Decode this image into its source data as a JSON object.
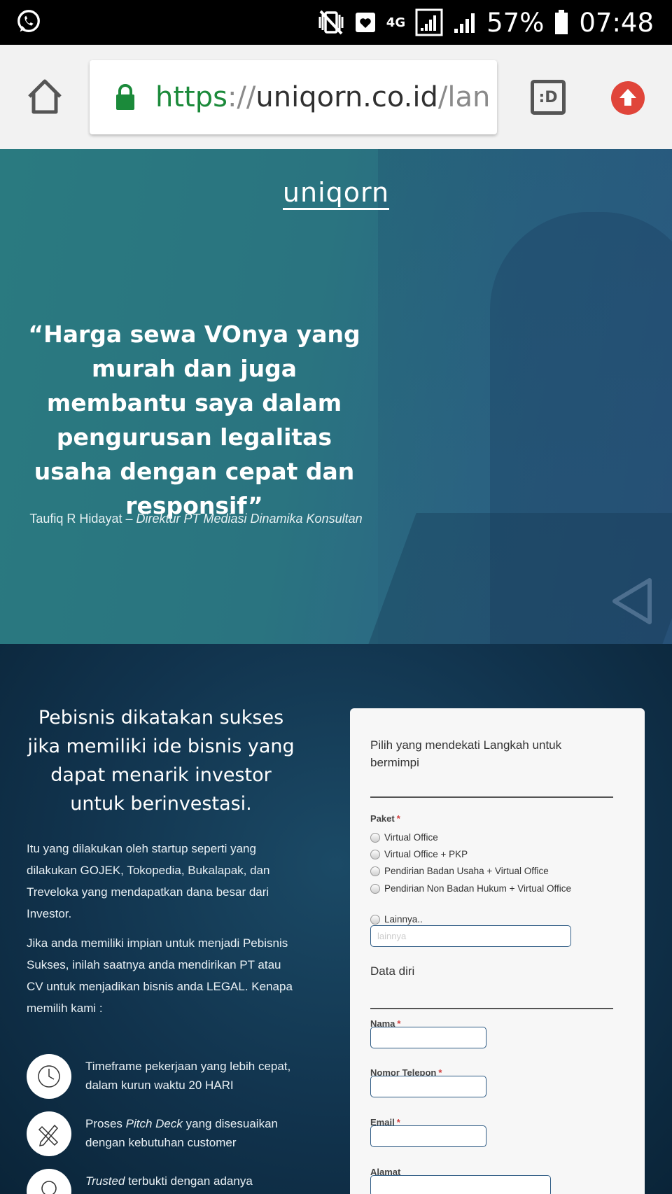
{
  "status_bar": {
    "battery": "57%",
    "time": "07:48",
    "network": "4G"
  },
  "browser": {
    "url_scheme": "https",
    "url_sep": "://",
    "url_host": "uniqorn.co.id",
    "url_path": "/lan",
    "reader_label": ":D"
  },
  "hero": {
    "brand": "uniqorn",
    "quote": "“Harga sewa VOnya yang murah dan juga membantu saya dalam pengurusan legalitas usaha dengan cepat dan responsif”",
    "author_name": "Taufiq R Hidayat",
    "author_dash": " – ",
    "author_title": "Direktur  PT Mediasi Dinamika Konsultan"
  },
  "main": {
    "headline": "Pebisnis dikatakan sukses jika memiliki ide bisnis yang dapat menarik investor untuk berinvestasi.",
    "para1": "Itu yang dilakukan oleh startup seperti yang dilakukan GOJEK, Tokopedia, Bukalapak, dan Treveloka yang mendapatkan dana besar dari Investor.",
    "para2": "Jika anda memiliki impian untuk menjadi Pebisnis Sukses, inilah saatnya anda mendirikan PT atau CV untuk menjadikan bisnis anda LEGAL. Kenapa memilih kami :",
    "features": [
      {
        "text": "Timeframe pekerjaan yang lebih cepat, dalam kurun waktu 20 HARI",
        "icon": "clock-icon"
      },
      {
        "pre": "Proses ",
        "em": "Pitch Deck",
        "post": " yang disesuaikan dengan kebutuhan customer",
        "icon": "pencil-ruler-icon"
      },
      {
        "em": "Trusted",
        "post": " terbukti dengan adanya",
        "icon": "bulb-icon"
      }
    ]
  },
  "form": {
    "title": "Pilih yang mendekati Langkah untuk bermimpi",
    "paket_label": "Paket",
    "required_mark": "*",
    "options": [
      "Virtual Office",
      "Virtual Office + PKP",
      "Pendirian Badan Usaha + Virtual Office",
      "Pendirian Non Badan Hukum + Virtual Office",
      "Lainnya.."
    ],
    "lainnya_placeholder": "lainnya",
    "section_data_diri": "Data diri",
    "nama_label": "Nama",
    "telepon_label": "Nomor Telepon",
    "email_label": "Email",
    "alamat_label": "Alamat"
  },
  "colors": {
    "hero_teal": "#2a7a80",
    "dark_navy": "#11334d",
    "required_red": "#d23c3c",
    "url_green": "#1b8a3a",
    "update_red": "#e0453a"
  }
}
